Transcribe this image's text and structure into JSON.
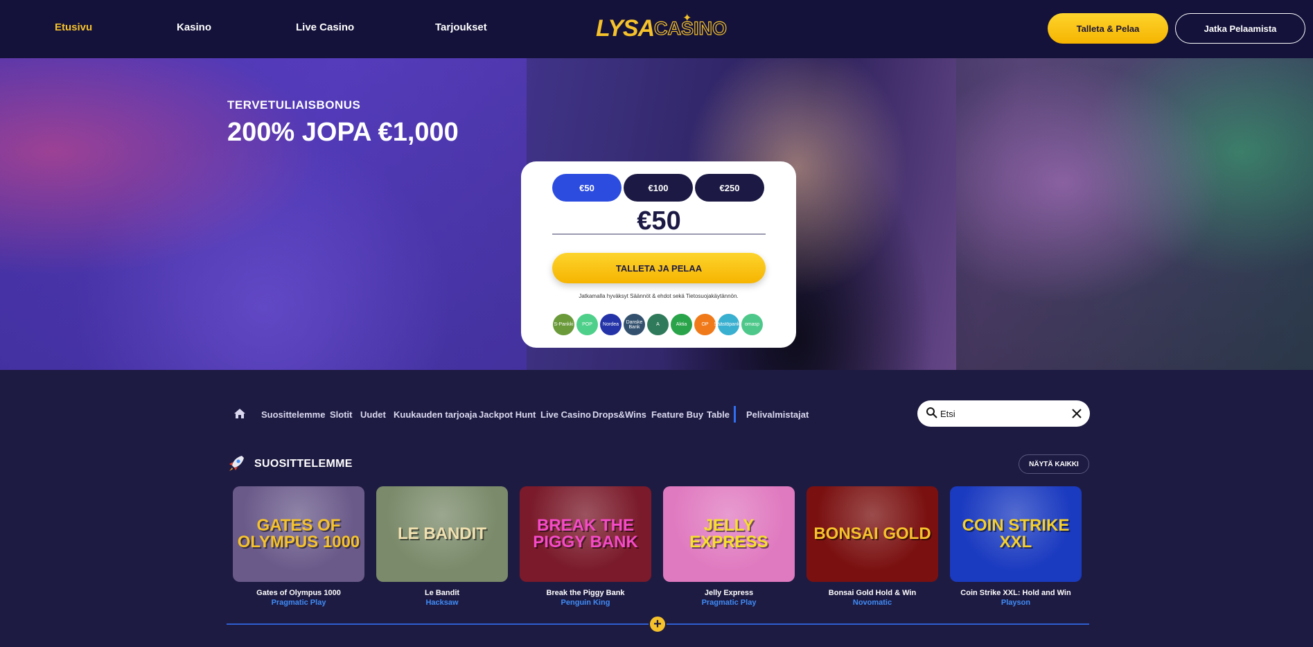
{
  "header": {
    "nav": [
      {
        "label": "Etusivu",
        "active": true
      },
      {
        "label": "Kasino",
        "active": false
      },
      {
        "label": "Live Casino",
        "active": false
      },
      {
        "label": "Tarjoukset",
        "active": false
      }
    ],
    "logo": {
      "part1": "LYSA",
      "part2": "CASINO"
    },
    "deposit_button": "Talleta & Pelaa",
    "continue_button": "Jatka Pelaamista"
  },
  "hero": {
    "eyebrow": "TERVETULIAISBONUS",
    "title": "200% JOPA €1,000",
    "card": {
      "amounts": [
        "€50",
        "€100",
        "€250"
      ],
      "selected_amount": "€50",
      "amount_value": "€50",
      "cta": "TALLETA JA PELAA",
      "terms": "Jatkamalla hyväksyt Säännöt & ehdot sekä Tietosuojakäytännön.",
      "banks": [
        {
          "label": "S-Pankki",
          "color": "#6a9a3a"
        },
        {
          "label": "POP",
          "color": "#4fd08a"
        },
        {
          "label": "Nordea",
          "color": "#2434a8"
        },
        {
          "label": "Danske Bank",
          "color": "#33516e"
        },
        {
          "label": "A",
          "color": "#2f7a5a"
        },
        {
          "label": "Aktia",
          "color": "#2aa44a"
        },
        {
          "label": "OP",
          "color": "#f07a1a"
        },
        {
          "label": "Säästöpankki",
          "color": "#3ab0d0"
        },
        {
          "label": "omasp",
          "color": "#4ec88a"
        }
      ]
    }
  },
  "categories": {
    "items": [
      "Suosittelemme",
      "Slotit",
      "Uudet",
      "Kuukauden tarjoaja",
      "Jackpot Hunt",
      "Live Casino",
      "Drops&Wins",
      "Feature Buy",
      "Table"
    ],
    "providers_label": "Pelivalmistajat"
  },
  "search": {
    "placeholder": "Etsi"
  },
  "section": {
    "title": "SUOSITTELEMME",
    "view_all": "NÄYTÄ KAIKKI",
    "games": [
      {
        "name": "Gates of Olympus 1000",
        "provider": "Pragmatic Play",
        "art": "GATES OF OLYMPUS 1000",
        "bg": "#6a5a8a",
        "fg": "#f6c22b"
      },
      {
        "name": "Le Bandit",
        "provider": "Hacksaw",
        "art": "LE BANDIT",
        "bg": "#7a8a6a",
        "fg": "#f0e0b0"
      },
      {
        "name": "Break the Piggy Bank",
        "provider": "Penguin King",
        "art": "BREAK THE PIGGY BANK",
        "bg": "#7a1a2a",
        "fg": "#f64ac8"
      },
      {
        "name": "Jelly Express",
        "provider": "Pragmatic Play",
        "art": "JELLY EXPRESS",
        "bg": "#e07ac0",
        "fg": "#f6e02b"
      },
      {
        "name": "Bonsai Gold Hold & Win",
        "provider": "Novomatic",
        "art": "BONSAI GOLD",
        "bg": "#7a1010",
        "fg": "#f6c22b"
      },
      {
        "name": "Coin Strike XXL: Hold and Win",
        "provider": "Playson",
        "art": "COIN STRIKE XXL",
        "bg": "#1a3ac0",
        "fg": "#f6d02b"
      }
    ]
  },
  "expand_label": "+",
  "colors": {
    "accent": "#f6c22b",
    "brand_blue": "#2c4ce0",
    "background": "#1e1b42",
    "header": "#14123a",
    "provider": "#3f8cf7"
  }
}
